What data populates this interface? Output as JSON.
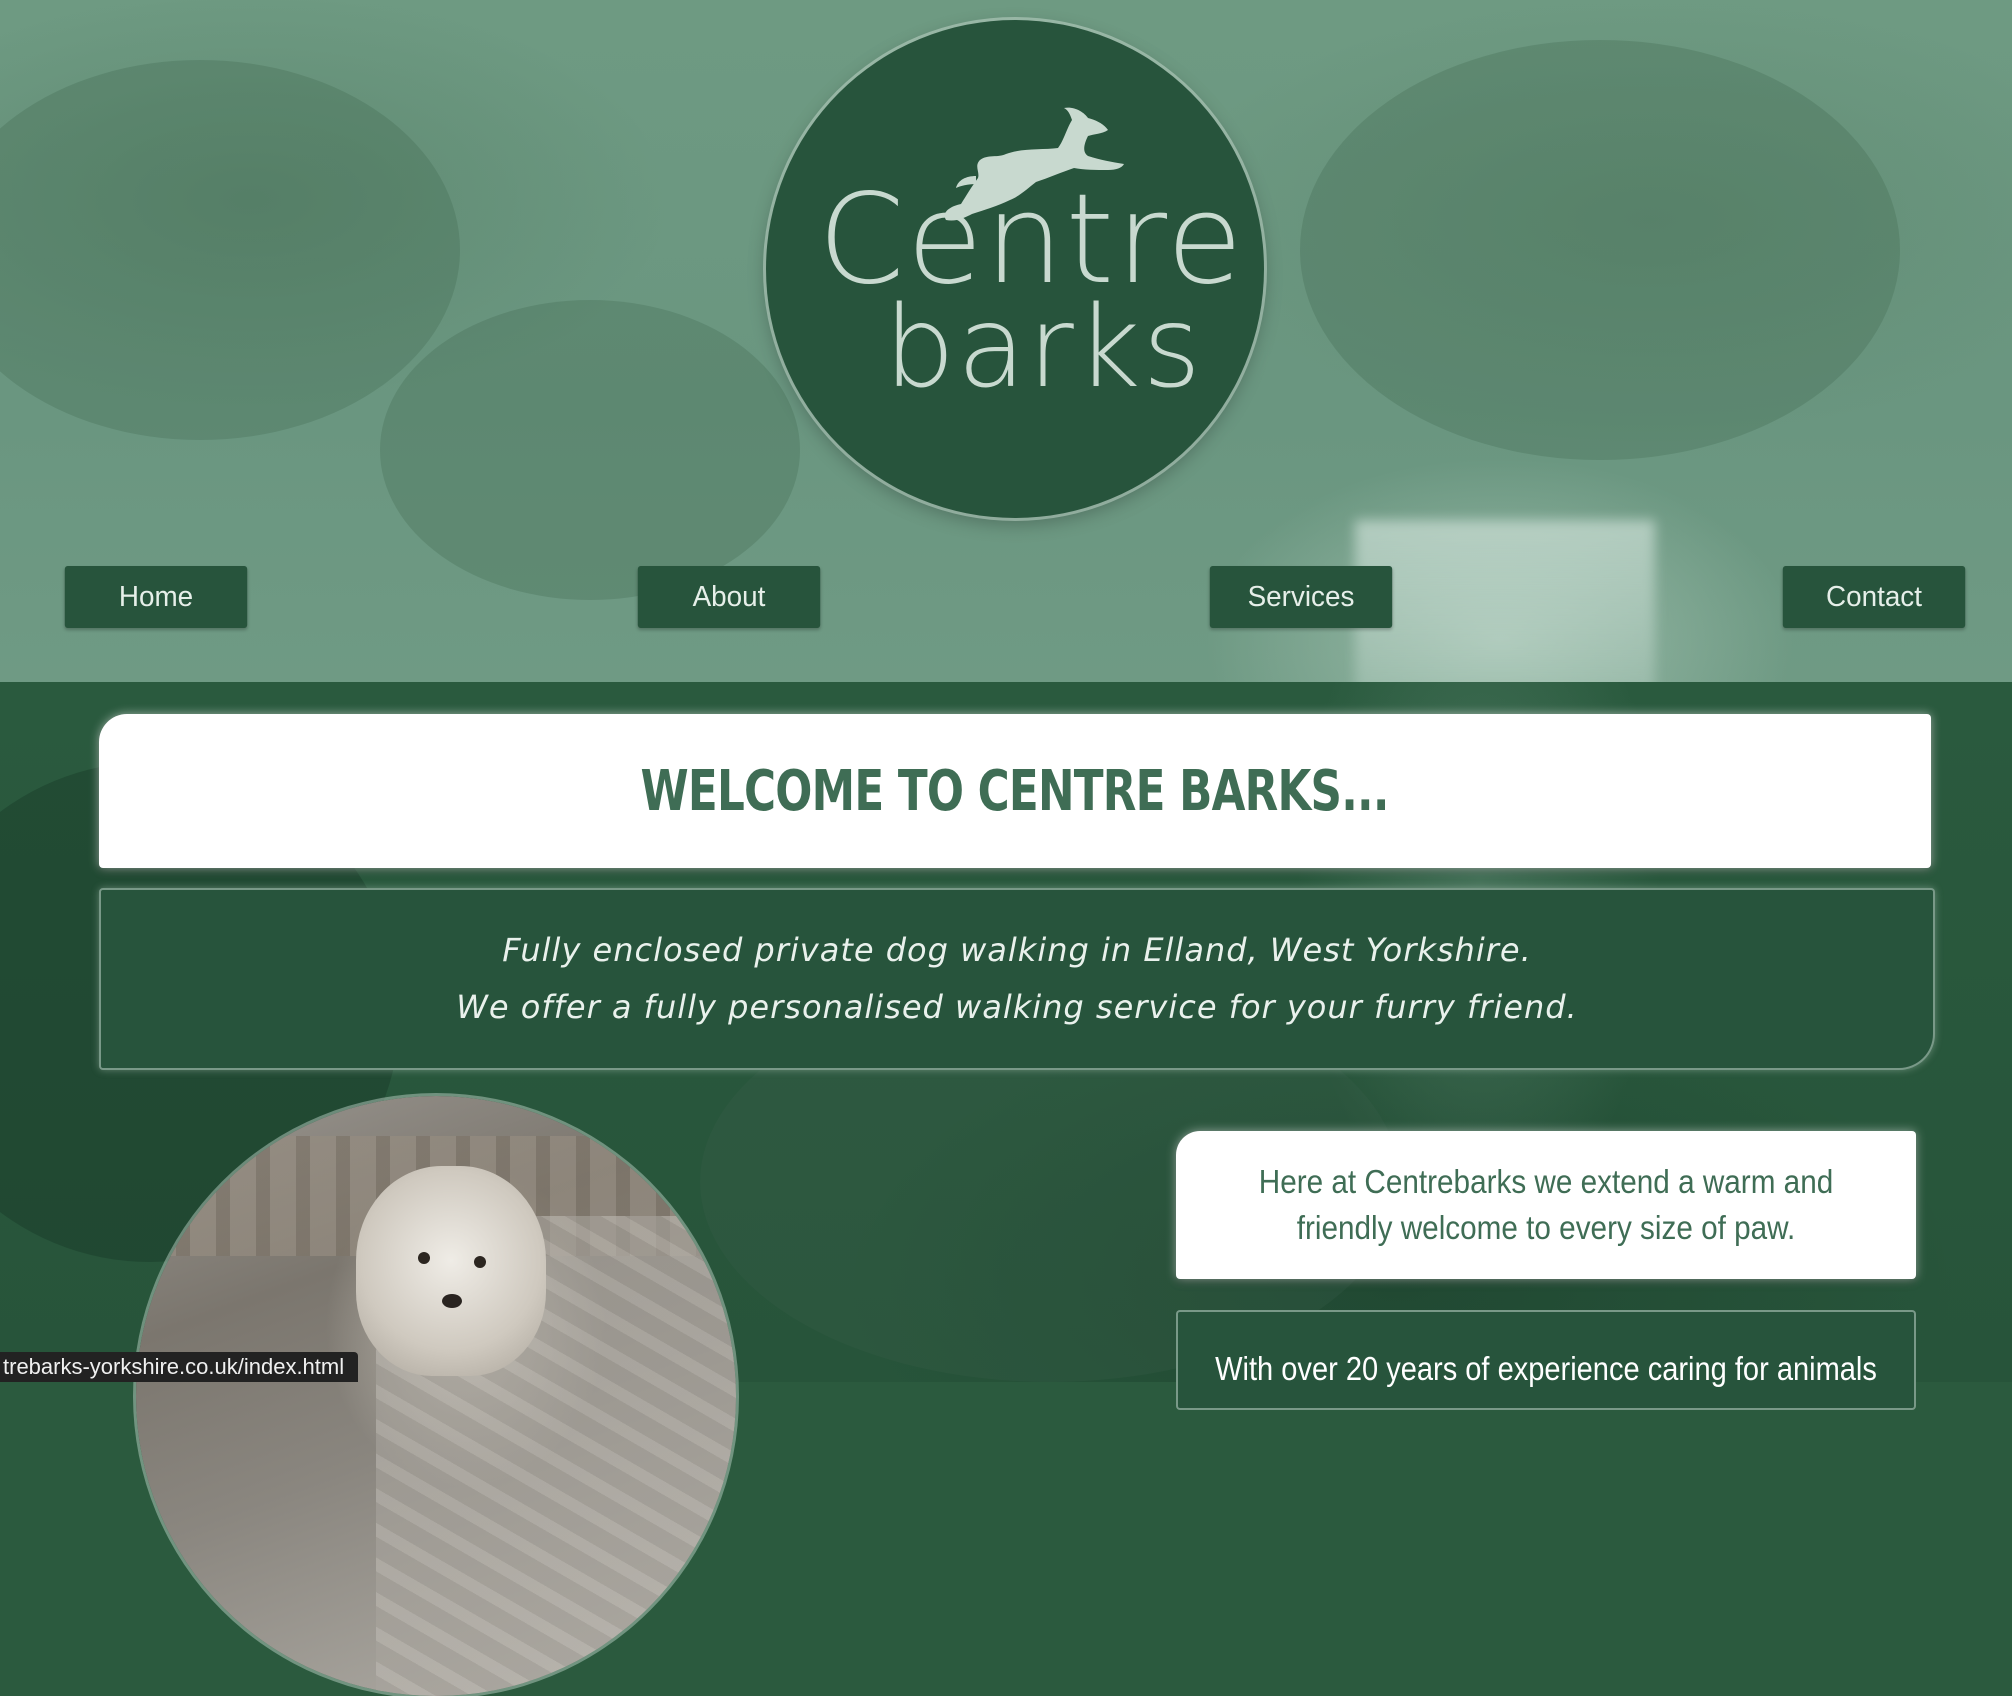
{
  "logo": {
    "line1": "Centre",
    "line2": "barks",
    "icon": "leaping-dog-icon"
  },
  "nav": {
    "items": [
      {
        "label": "Home"
      },
      {
        "label": "About"
      },
      {
        "label": "Services"
      },
      {
        "label": "Contact"
      }
    ]
  },
  "welcome": {
    "title": "WELCOME TO CENTRE BARKS..."
  },
  "intro": {
    "line1": "Fully enclosed private dog walking in Elland, West Yorkshire.",
    "line2": "We offer a fully personalised walking service for your furry friend."
  },
  "cards": {
    "greeting": "Here at Centrebarks we extend a warm and friendly welcome to every size of paw.",
    "experience": "With over 20 years of experience caring for animals"
  },
  "status_bar": {
    "url": "trebarks-yorkshire.co.uk/index.html"
  },
  "colors": {
    "brand_green": "#27543c",
    "header_green": "#6e9a82",
    "title_green": "#3f6d55",
    "logo_text": "#c8d9cf"
  }
}
